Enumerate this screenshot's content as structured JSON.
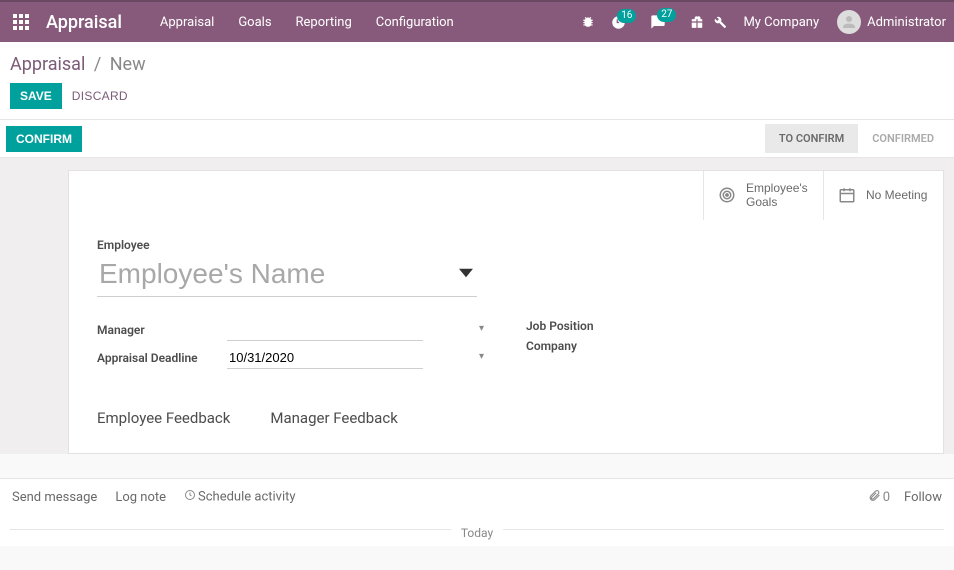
{
  "nav": {
    "brand": "Appraisal",
    "menu": [
      "Appraisal",
      "Goals",
      "Reporting",
      "Configuration"
    ],
    "debug_badge": "16",
    "msg_badge": "27",
    "company": "My Company",
    "user": "Administrator"
  },
  "breadcrumb": {
    "root": "Appraisal",
    "current": "New"
  },
  "actions": {
    "save": "SAVE",
    "discard": "DISCARD",
    "confirm": "CONFIRM"
  },
  "statusbar": {
    "stages": [
      "TO CONFIRM",
      "CONFIRMED"
    ],
    "active_index": 0
  },
  "stat_buttons": {
    "goals": "Employee's\nGoals",
    "meeting": "No Meeting"
  },
  "form": {
    "employee_label": "Employee",
    "employee_placeholder": "Employee's Name",
    "manager_label": "Manager",
    "manager_value": "",
    "deadline_label": "Appraisal Deadline",
    "deadline_value": "10/31/2020",
    "job_label": "Job Position",
    "company_label": "Company"
  },
  "tabs": {
    "emp_feedback": "Employee Feedback",
    "mgr_feedback": "Manager Feedback"
  },
  "chatter": {
    "send": "Send message",
    "log": "Log note",
    "schedule": "Schedule activity",
    "attach_count": "0",
    "follow": "Follow",
    "today": "Today"
  }
}
